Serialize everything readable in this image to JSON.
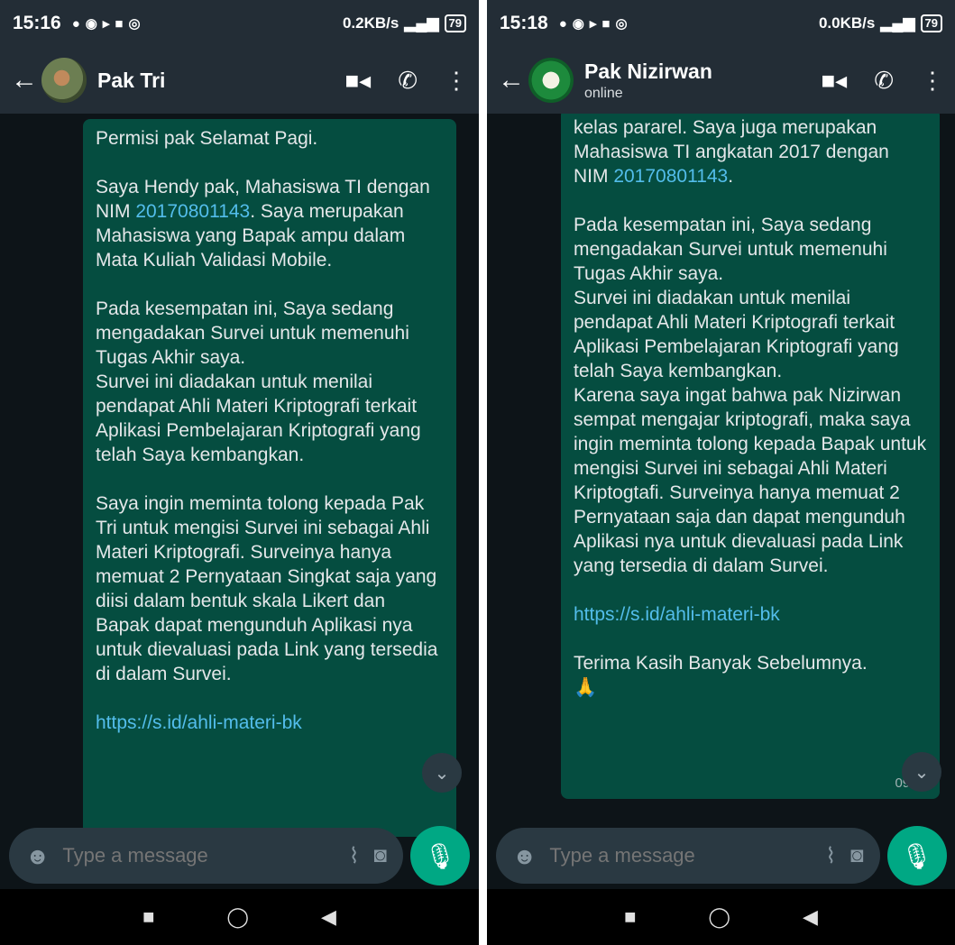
{
  "left": {
    "status": {
      "time": "15:16",
      "net": "0.2KB/s",
      "battery": "79"
    },
    "contact": {
      "name": "Pak Tri"
    },
    "message": {
      "paragraphs": [
        "Permisi pak Selamat Pagi.",
        "Saya Hendy pak, Mahasiswa TI dengan NIM ",
        "Pada kesempatan ini, Saya sedang mengadakan Survei untuk memenuhi Tugas Akhir saya.\nSurvei ini diadakan untuk menilai pendapat Ahli Materi Kriptografi terkait Aplikasi Pembelajaran Kriptografi yang telah Saya kembangkan.",
        "Saya ingin meminta tolong kepada Pak Tri untuk mengisi Survei ini sebagai Ahli Materi Kriptografi. Surveinya hanya memuat 2 Pernyataan Singkat saja yang diisi dalam bentuk skala Likert dan Bapak dapat mengunduh Aplikasi nya untuk dievaluasi pada Link yang tersedia di dalam Survei."
      ],
      "nim": "20170801143",
      "after_nim": ". Saya merupakan Mahasiswa yang Bapak ampu dalam Mata Kuliah Validasi Mobile.",
      "link": "https://s.id/ahli-materi-bk"
    },
    "input": {
      "placeholder": "Type a message"
    }
  },
  "right": {
    "status": {
      "time": "15:18",
      "net": "0.0KB/s",
      "battery": "79"
    },
    "contact": {
      "name": "Pak Nizirwan",
      "status": "online"
    },
    "message": {
      "intro": "kelas pararel. Saya juga merupakan Mahasiswa TI angkatan 2017 dengan NIM ",
      "nim": "20170801143",
      "intro_end": ".",
      "paragraphs": [
        "Pada kesempatan ini, Saya sedang mengadakan Survei untuk memenuhi Tugas Akhir saya.\nSurvei ini diadakan untuk menilai pendapat Ahli Materi Kriptografi terkait Aplikasi Pembelajaran Kriptografi yang telah Saya kembangkan.\nKarena saya ingat bahwa pak Nizirwan sempat mengajar kriptografi, maka saya ingin meminta tolong kepada Bapak untuk mengisi Survei ini sebagai Ahli Materi Kriptogtafi. Surveinya hanya memuat 2 Pernyataan saja dan dapat mengunduh Aplikasi nya untuk dievaluasi pada Link yang tersedia di dalam Survei."
      ],
      "link": "https://s.id/ahli-materi-bk",
      "closing": "Terima Kasih Banyak Sebelumnya.",
      "emoji": "🙏",
      "time": "09:37"
    },
    "input": {
      "placeholder": "Type a message"
    }
  },
  "icons": {
    "back": "arrow-left-icon",
    "video": "video-camera-icon",
    "call": "phone-icon",
    "menu": "more-vert-icon",
    "emoji": "emoji-icon",
    "attach": "paperclip-icon",
    "camera": "camera-icon",
    "mic": "microphone-icon",
    "scroll": "chevron-double-down-icon"
  },
  "colors": {
    "bubble": "#054d40",
    "accent": "#00a884",
    "link": "#53bdeb"
  }
}
